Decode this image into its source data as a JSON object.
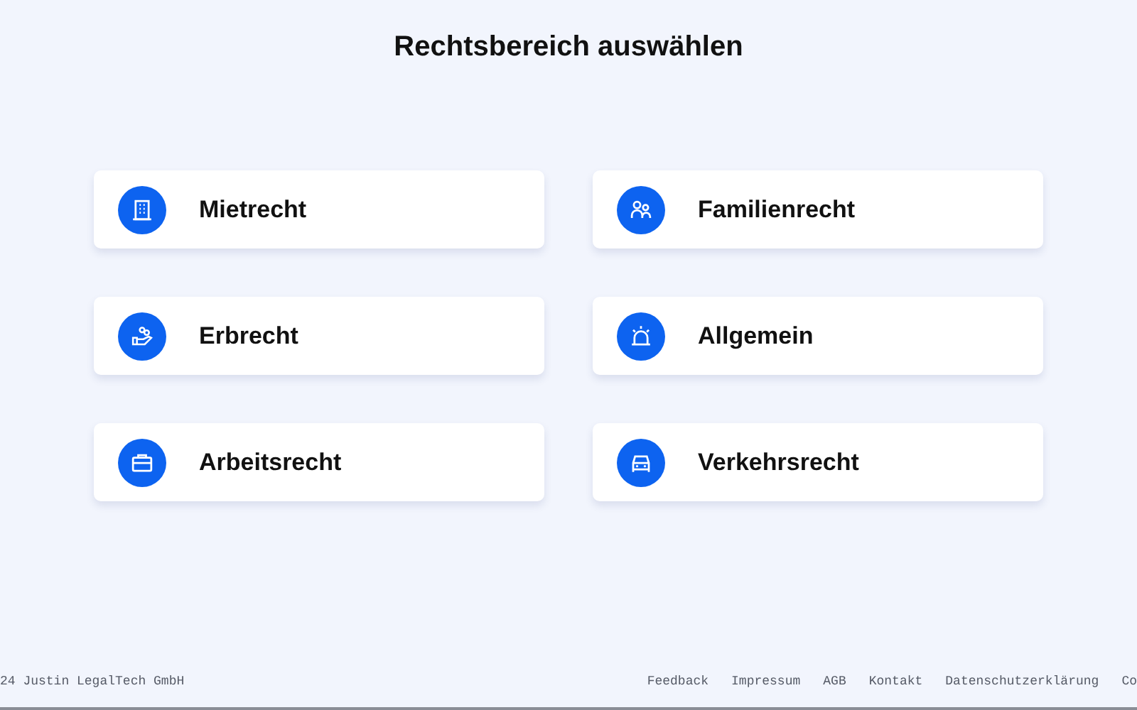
{
  "title": "Rechtsbereich auswählen",
  "areas": [
    {
      "label": "Mietrecht",
      "kind": "building"
    },
    {
      "label": "Familienrecht",
      "kind": "people"
    },
    {
      "label": "Erbrecht",
      "kind": "inheritance"
    },
    {
      "label": "Allgemein",
      "kind": "siren"
    },
    {
      "label": "Arbeitsrecht",
      "kind": "briefcase"
    },
    {
      "label": "Verkehrsrecht",
      "kind": "car"
    }
  ],
  "footer": {
    "copyright": "24 Justin LegalTech GmbH",
    "links": [
      "Feedback",
      "Impressum",
      "AGB",
      "Kontakt",
      "Datenschutzerklärung",
      "Co"
    ]
  }
}
